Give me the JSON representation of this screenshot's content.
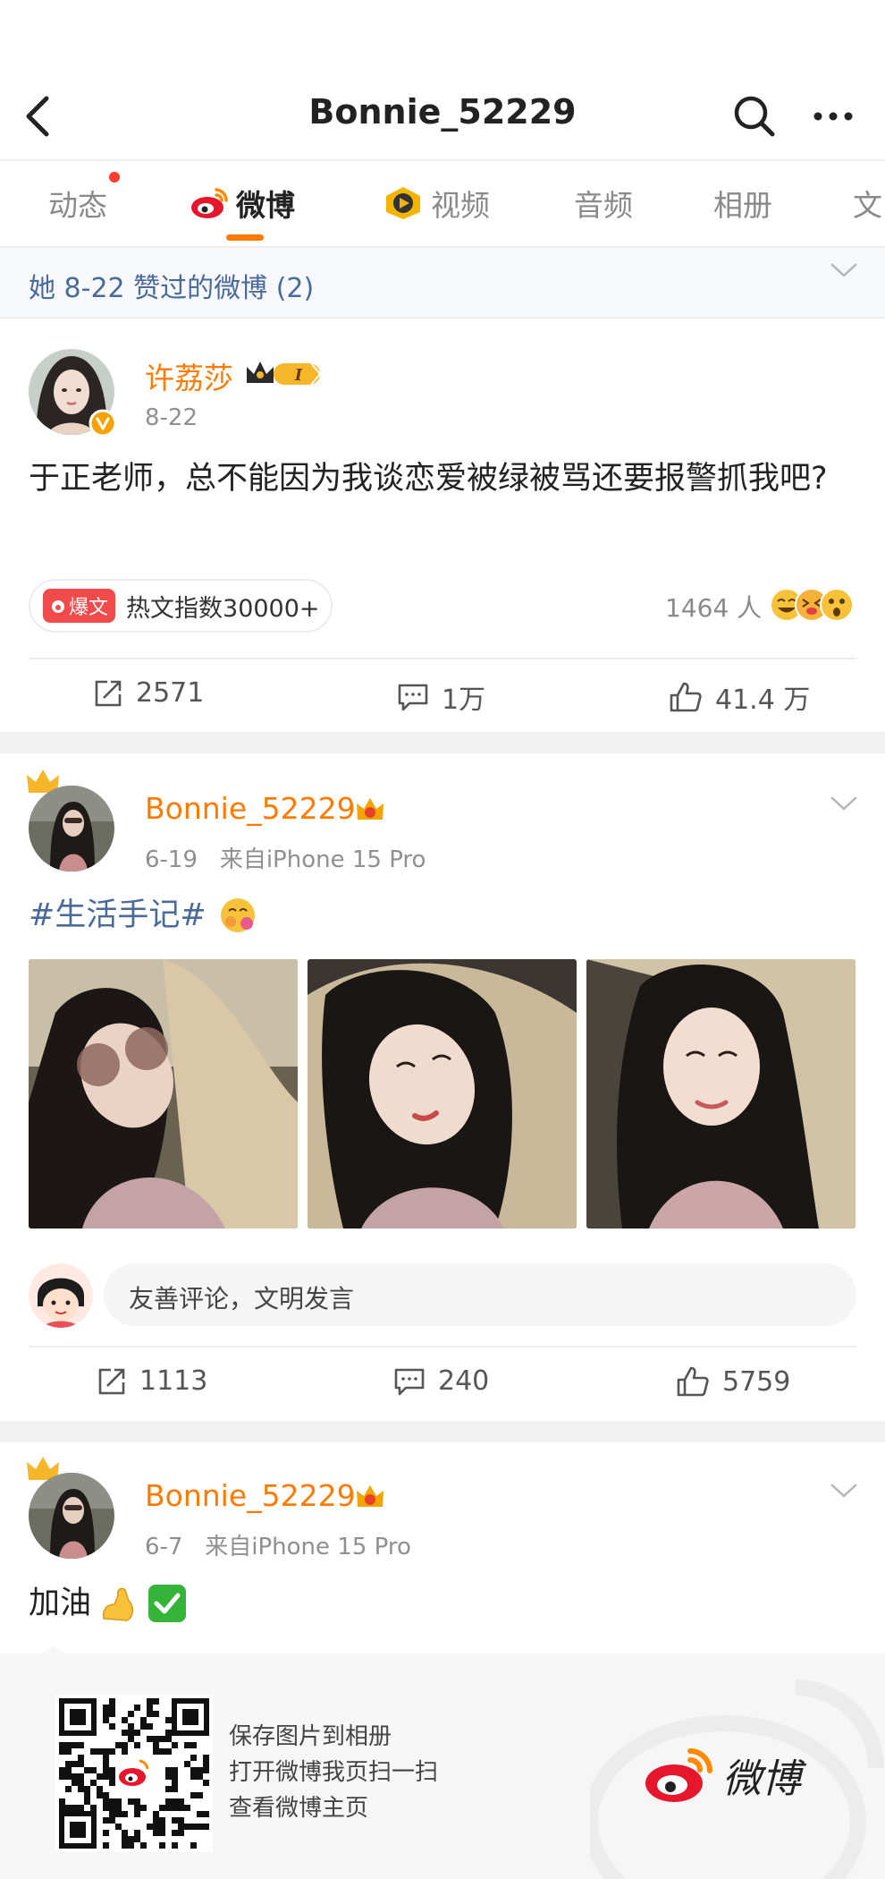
{
  "header": {
    "title": "Bonnie_52229",
    "back_icon": "chevron-left-icon",
    "search_icon": "search-icon",
    "more_icon": "more-dots-icon"
  },
  "tabs": [
    {
      "label": "动态",
      "active": false,
      "dot": true
    },
    {
      "label": "微博",
      "active": true,
      "icon": "weibo-logo-icon"
    },
    {
      "label": "视频",
      "active": false,
      "icon": "video-icon"
    },
    {
      "label": "音频",
      "active": false
    },
    {
      "label": "相册",
      "active": false
    },
    {
      "label": "文",
      "active": false
    }
  ],
  "liked_banner": {
    "text": "她 8-22 赞过的微博 (2)"
  },
  "posts": [
    {
      "author": "许荔莎",
      "date": "8-22",
      "verified": true,
      "text": "于正老师，总不能因为我谈恋爱被绿被骂还要报警抓我吧?",
      "hot_badge": "爆文",
      "hot_text": "热文指数30000+",
      "people": "1464 人",
      "shares": "2571",
      "comments": "1万",
      "likes": "41.4 万"
    },
    {
      "author": "Bonnie_52229",
      "date": "6-19",
      "source": "来自iPhone 15 Pro",
      "text": "#生活手记#",
      "comment_placeholder": "友善评论，文明发言",
      "shares": "1113",
      "comments": "240",
      "likes": "5759"
    },
    {
      "author": "Bonnie_52229",
      "date": "6-7",
      "source": "来自iPhone 15 Pro",
      "text": "加油"
    }
  ],
  "footer": {
    "line1": "保存图片到相册",
    "line2": "打开微博我页扫一扫",
    "line3": "查看微博主页",
    "logo_text": "微博"
  },
  "colors": {
    "accent": "#ff7a00",
    "link_blue": "#4a6a9a",
    "hot_red": "#f04a4a"
  }
}
